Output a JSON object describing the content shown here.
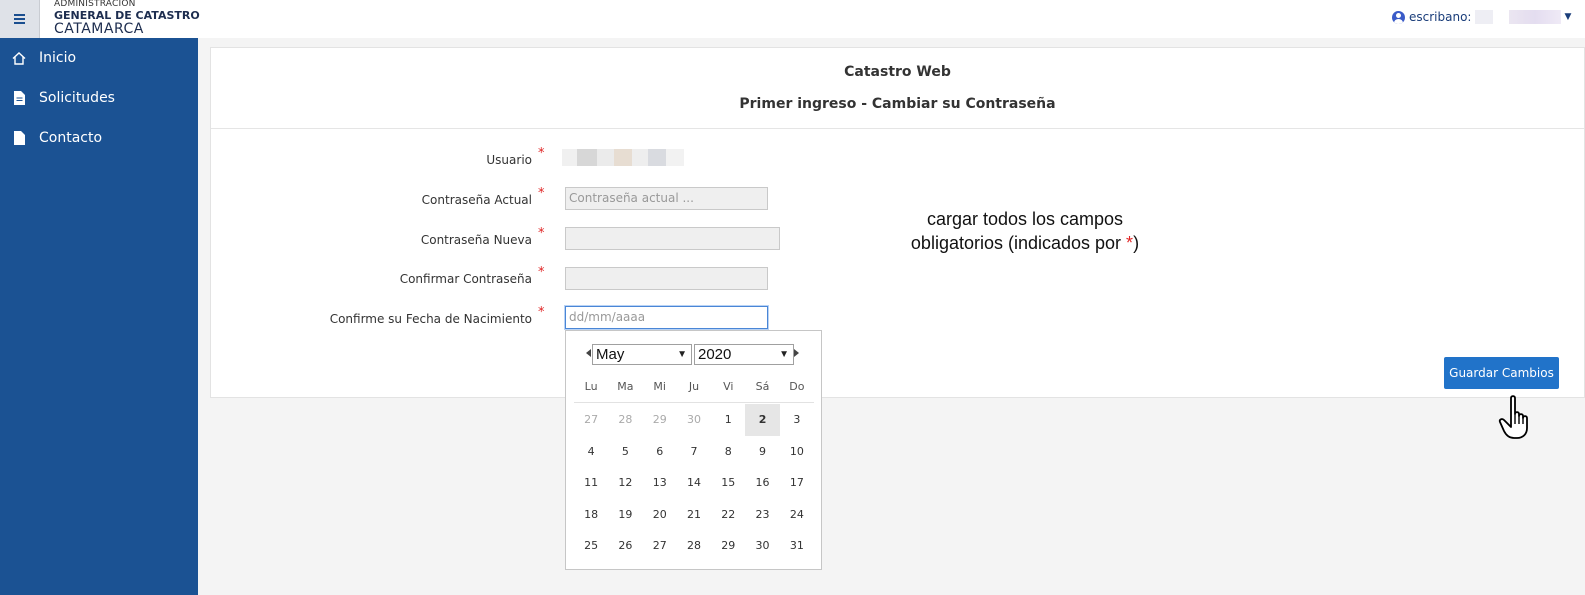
{
  "header": {
    "logo_line1": "ADMINISTRACIÓN",
    "logo_line2": "GENERAL DE CATASTRO",
    "logo_line3": "CATAMARCA",
    "user_label": "escribano:"
  },
  "sidebar": {
    "items": [
      {
        "label": "Inicio",
        "icon": "home-icon"
      },
      {
        "label": "Solicitudes",
        "icon": "document-icon"
      },
      {
        "label": "Contacto",
        "icon": "document-icon"
      }
    ]
  },
  "panel": {
    "title": "Catastro Web",
    "subtitle": "Primer ingreso - Cambiar su Contraseña"
  },
  "form": {
    "required_mark": "*",
    "usuario_label": "Usuario",
    "actual_label": "Contraseña Actual",
    "actual_placeholder": "Contraseña actual ...",
    "nueva_label": "Contraseña Nueva",
    "confirmar_label": "Confirmar Contraseña",
    "fecha_label": "Confirme su Fecha de Nacimiento",
    "fecha_placeholder": "dd/mm/aaaa"
  },
  "note": {
    "line1": "cargar todos los campos",
    "line2": "obligatorios (indicados por ",
    "star": "*",
    "line2_end": ")"
  },
  "save_button": "Guardar Cambios",
  "datepicker": {
    "month": "May",
    "year": "2020",
    "weekdays": [
      "Lu",
      "Ma",
      "Mi",
      "Ju",
      "Vi",
      "Sá",
      "Do"
    ],
    "weeks": [
      [
        "27",
        "28",
        "29",
        "30",
        "1",
        "2",
        "3"
      ],
      [
        "4",
        "5",
        "6",
        "7",
        "8",
        "9",
        "10"
      ],
      [
        "11",
        "12",
        "13",
        "14",
        "15",
        "16",
        "17"
      ],
      [
        "18",
        "19",
        "20",
        "21",
        "22",
        "23",
        "24"
      ],
      [
        "25",
        "26",
        "27",
        "28",
        "29",
        "30",
        "31"
      ]
    ],
    "today": "2"
  },
  "colors": {
    "sidebar": "#1b5293",
    "accent": "#2173c9",
    "required": "#e02424"
  }
}
